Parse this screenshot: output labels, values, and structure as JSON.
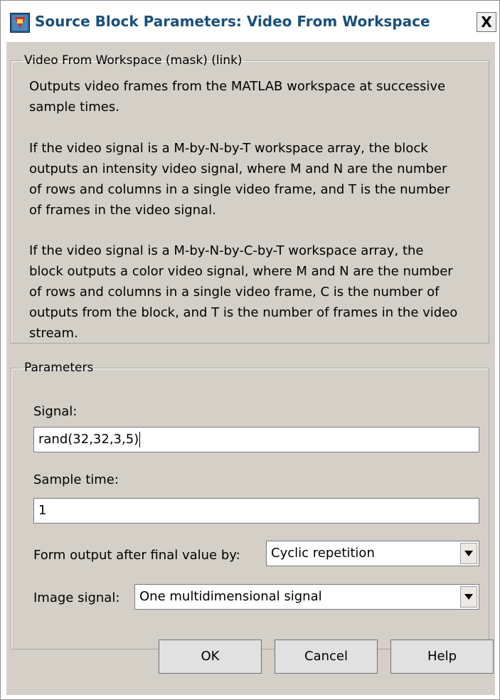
{
  "window": {
    "title": "Source Block Parameters: Video From Workspace",
    "close_glyph": "X",
    "icon": "simulink-block-icon"
  },
  "mask_group": {
    "title": "Video From Workspace (mask) (link)",
    "paragraphs": [
      [
        "Outputs video frames from the MATLAB workspace at successive",
        "sample times."
      ],
      [
        "If the video signal is a M-by-N-by-T workspace array, the block",
        "outputs an intensity video signal, where M and N are the number",
        "of rows and columns in a single video frame, and T is the number",
        "of frames in the video signal."
      ],
      [
        "If the video signal is a M-by-N-by-C-by-T workspace array, the",
        "block outputs a color video signal, where M and N are the number",
        "of rows and columns in a single video frame, C is the number of",
        "outputs from the block, and T is the number of frames in the video",
        "stream."
      ]
    ]
  },
  "parameters": {
    "title": "Parameters",
    "signal_label": "Signal:",
    "signal_value": "rand(32,32,3,5)",
    "sample_time_label": "Sample time:",
    "sample_time_value": "1",
    "form_output_label": "Form output after final value by:",
    "form_output_value": "Cyclic repetition",
    "image_signal_label": "Image signal:",
    "image_signal_value": "One multidimensional signal"
  },
  "buttons": {
    "ok": "OK",
    "cancel": "Cancel",
    "help": "Help"
  },
  "colors": {
    "dialog_bg": "#d4d0c8",
    "title_text": "#1a4f7a"
  }
}
